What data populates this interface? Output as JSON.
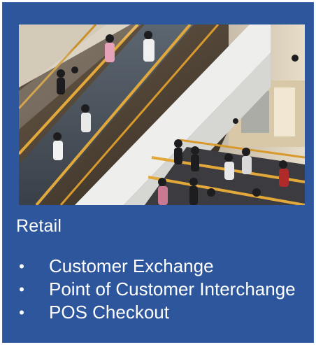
{
  "card": {
    "photo_alt": "",
    "title": "Retail",
    "bullet_char": "•",
    "items": [
      {
        "label": "Customer Exchange"
      },
      {
        "label": "Point of Customer Interchange"
      },
      {
        "label": "POS Checkout"
      }
    ]
  },
  "colors": {
    "card_background": "#2d569c",
    "text": "#ffffff"
  }
}
